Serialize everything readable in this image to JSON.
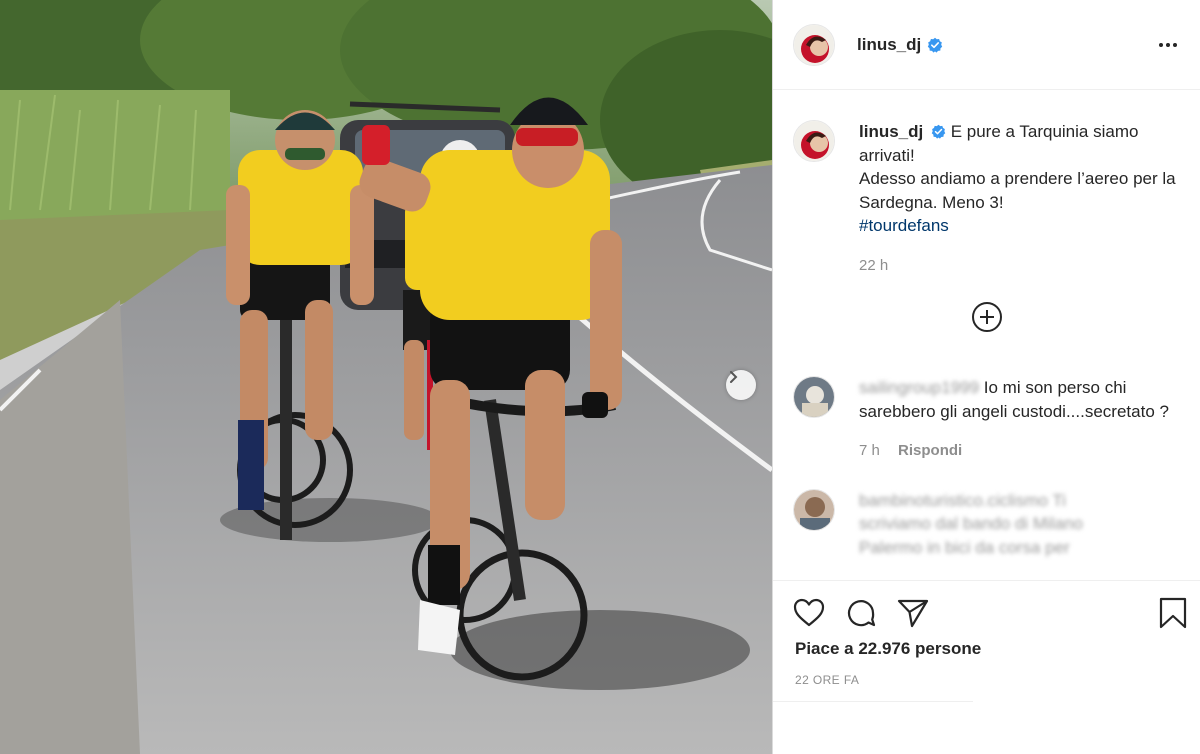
{
  "post": {
    "username": "linus_dj",
    "verified": true,
    "caption_line1": "E pure a Tarquinia siamo arrivati!",
    "caption_line2": "Adesso andiamo a prendere l’aereo per la Sardegna. Meno 3!",
    "hashtag": "#tourdefans",
    "caption_time": "22 h"
  },
  "comments": [
    {
      "username_blurred": "sailingroup1999",
      "text": "Io mi son perso chi sarebbero gli angeli custodi....secretato ?",
      "time": "7 h",
      "reply_label": "Rispondi"
    },
    {
      "text_blurred_line1": "bambinoturistico.ciclismo Ti",
      "text_blurred_line2": "scriviamo dal bando di Milano",
      "text_blurred_line3": "Palermo in bici da corsa per"
    }
  ],
  "footer": {
    "likes": "Piace a 22.976 persone",
    "date": "22 ORE FA"
  },
  "colors": {
    "verified_blue": "#3897f0",
    "hashtag": "#00376b",
    "jersey_yellow": "#f2cd1f"
  },
  "icons": [
    "more-options-icon",
    "verified-icon",
    "add-comment-icon",
    "heart-icon",
    "comment-icon",
    "share-icon",
    "bookmark-icon",
    "chevron-right-icon"
  ]
}
